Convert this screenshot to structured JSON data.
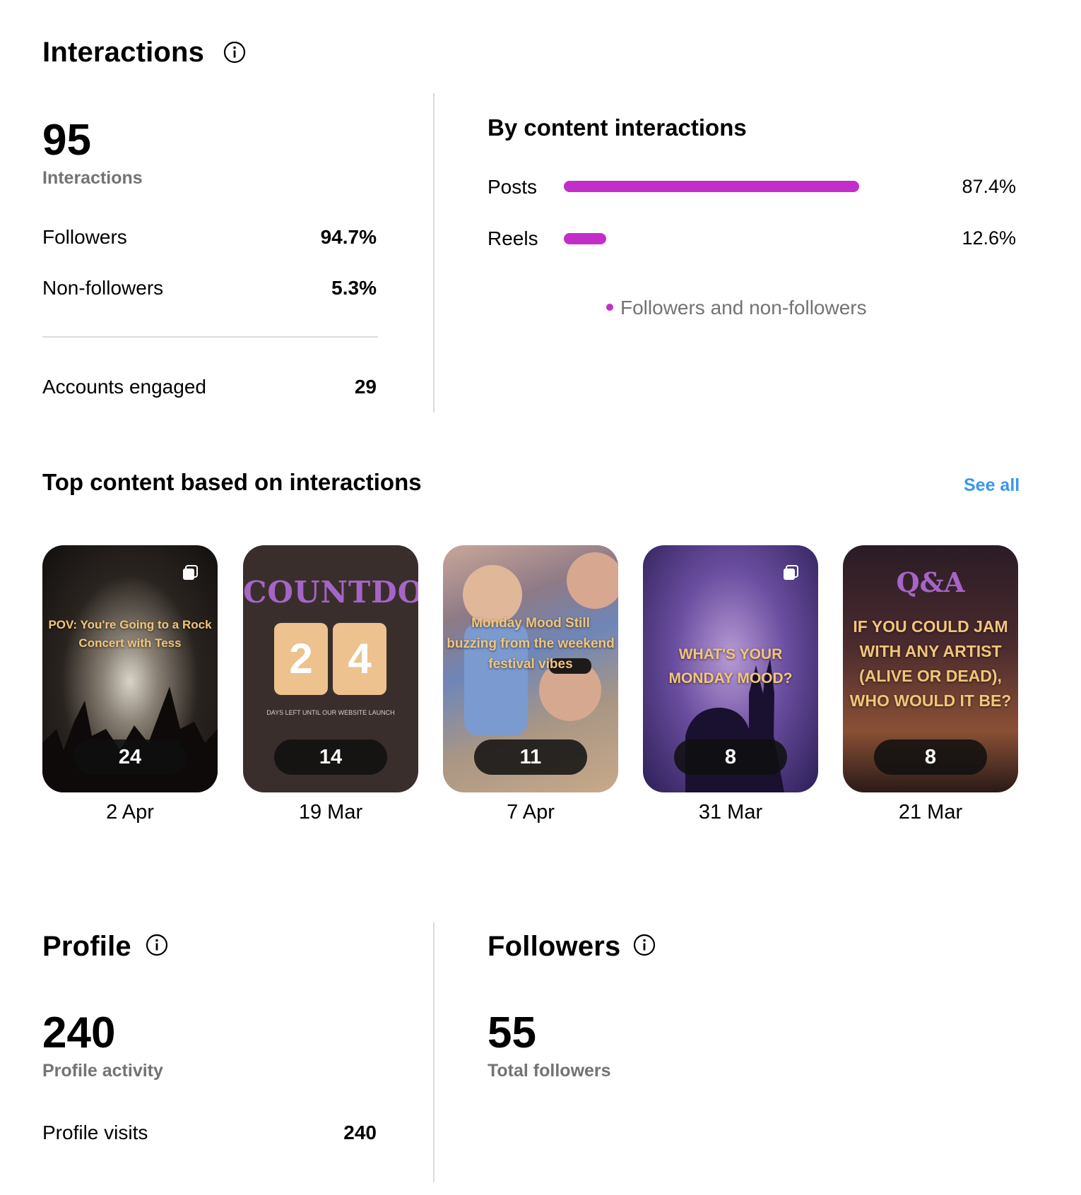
{
  "interactions": {
    "title": "Interactions",
    "total": "95",
    "total_label": "Interactions",
    "rows": [
      {
        "label": "Followers",
        "value": "94.7%"
      },
      {
        "label": "Non-followers",
        "value": "5.3%"
      }
    ],
    "accounts_engaged_label": "Accounts engaged",
    "accounts_engaged_value": "29"
  },
  "by_content": {
    "title": "By content interactions",
    "items": [
      {
        "label": "Posts",
        "value": "87.4%",
        "fraction": 0.874
      },
      {
        "label": "Reels",
        "value": "12.6%",
        "fraction": 0.126
      }
    ],
    "legend": "Followers and non-followers",
    "bar_color": "#c32ec8"
  },
  "top_content": {
    "title": "Top content based on interactions",
    "see_all": "See all",
    "items": [
      {
        "count": "24",
        "date": "2 Apr",
        "caption": "POV: You're Going to a Rock Concert with Tess"
      },
      {
        "count": "14",
        "date": "19 Mar",
        "caption": "COUNTDOWN",
        "digits": [
          "2",
          "4"
        ],
        "small_caption": "DAYS LEFT UNTIL OUR WEBSITE LAUNCH"
      },
      {
        "count": "11",
        "date": "7 Apr",
        "caption": "Monday Mood Still buzzing from the weekend festival vibes"
      },
      {
        "count": "8",
        "date": "31 Mar",
        "caption": "WHAT'S YOUR MONDAY MOOD?"
      },
      {
        "count": "8",
        "date": "21 Mar",
        "caption_title": "Q&A",
        "caption": "IF YOU COULD JAM WITH ANY ARTIST (ALIVE OR DEAD), WHO WOULD IT BE?"
      }
    ]
  },
  "profile": {
    "title": "Profile",
    "total": "240",
    "total_label": "Profile activity",
    "visits_label": "Profile visits",
    "visits_value": "240"
  },
  "followers": {
    "title": "Followers",
    "total": "55",
    "total_label": "Total followers"
  }
}
